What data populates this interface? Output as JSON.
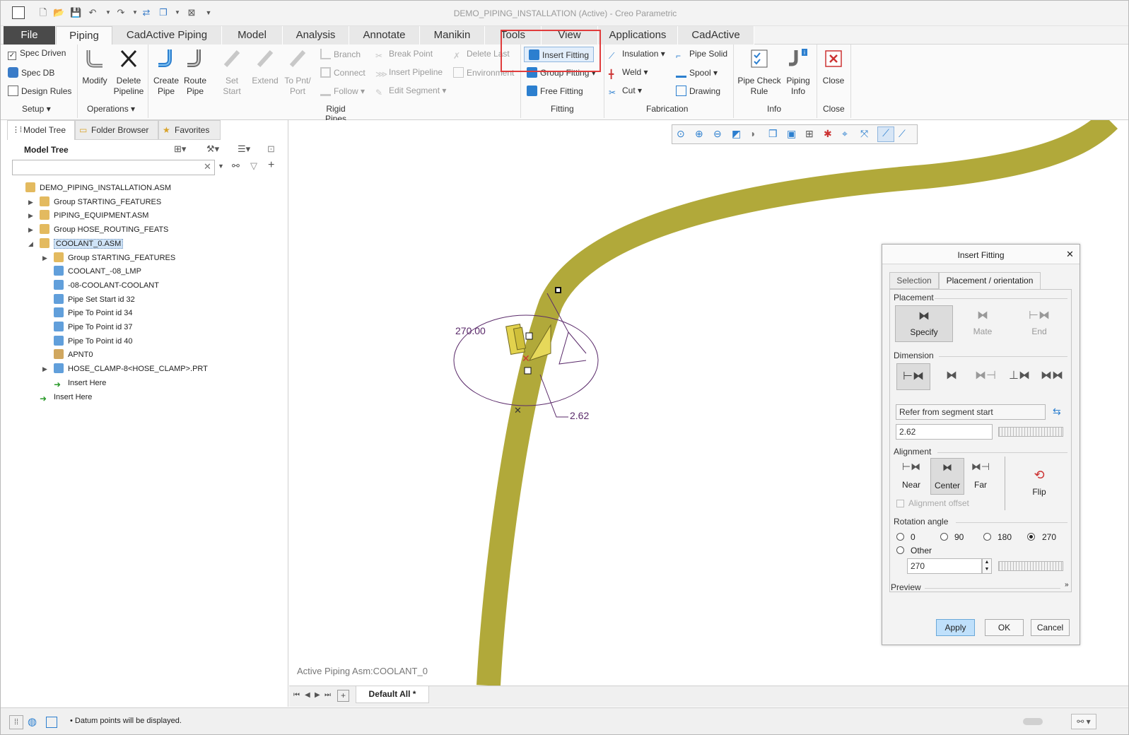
{
  "window": {
    "title": "DEMO_PIPING_INSTALLATION (Active) - Creo Parametric"
  },
  "menu_tabs": [
    {
      "label": "File"
    },
    {
      "label": "Piping"
    },
    {
      "label": "CadActive Piping"
    },
    {
      "label": "Model"
    },
    {
      "label": "Analysis"
    },
    {
      "label": "Annotate"
    },
    {
      "label": "Manikin"
    },
    {
      "label": "Tools"
    },
    {
      "label": "View"
    },
    {
      "label": "Applications"
    },
    {
      "label": "CadActive"
    }
  ],
  "ribbon": {
    "setup": {
      "spec_driven": "Spec Driven",
      "spec_db": "Spec DB",
      "design_rules": "Design Rules",
      "group": "Setup"
    },
    "operations": {
      "modify": "Modify",
      "delete_pipeline": "Delete Pipeline",
      "group": "Operations"
    },
    "rigid_pipes": {
      "create_pipe": "Create Pipe",
      "route_pipe": "Route Pipe",
      "set_start": "Set Start",
      "extend": "Extend",
      "to_pnt_port": "To Pnt/ Port",
      "branch": "Branch",
      "connect": "Connect",
      "follow": "Follow",
      "break_point": "Break Point",
      "insert_pipeline": "Insert Pipeline",
      "edit_segment": "Edit Segment",
      "delete_last": "Delete Last",
      "environment": "Environment",
      "group": "Rigid Pipes"
    },
    "fitting": {
      "insert_fitting": "Insert Fitting",
      "group_fitting": "Group Fitting",
      "free_fitting": "Free Fitting",
      "group": "Fitting"
    },
    "fabrication": {
      "insulation": "Insulation",
      "weld": "Weld",
      "cut": "Cut",
      "pipe_solid": "Pipe Solid",
      "spool": "Spool",
      "drawing": "Drawing",
      "group": "Fabrication"
    },
    "info": {
      "pipe_check_rule": "Pipe Check Rule",
      "piping_info": "Piping Info",
      "group": "Info"
    },
    "close": {
      "close": "Close",
      "group": "Close"
    }
  },
  "left_panel": {
    "tabs": [
      {
        "label": "Model Tree"
      },
      {
        "label": "Folder Browser"
      },
      {
        "label": "Favorites"
      }
    ],
    "header": "Model Tree",
    "search_placeholder": "",
    "tree": [
      {
        "label": "DEMO_PIPING_INSTALLATION.ASM"
      },
      {
        "label": "Group STARTING_FEATURES"
      },
      {
        "label": "PIPING_EQUIPMENT.ASM"
      },
      {
        "label": "Group HOSE_ROUTING_FEATS"
      },
      {
        "label": "COOLANT_0.ASM"
      },
      {
        "label": "Group STARTING_FEATURES"
      },
      {
        "label": "COOLANT_-08_LMP"
      },
      {
        "label": "-08-COOLANT-COOLANT"
      },
      {
        "label": "Pipe Set Start id 32"
      },
      {
        "label": "Pipe To Point id 34"
      },
      {
        "label": "Pipe To Point id 37"
      },
      {
        "label": "Pipe To Point id 40"
      },
      {
        "label": "APNT0"
      },
      {
        "label": "HOSE_CLAMP-8<HOSE_CLAMP>.PRT"
      },
      {
        "label": "Insert Here"
      },
      {
        "label": "Insert Here"
      }
    ]
  },
  "viewport": {
    "angle_dim": "270.00",
    "offset_dim": "2.62",
    "active_asm": "Active Piping Asm:COOLANT_0",
    "pipe_color": "#b1a93a"
  },
  "dialog": {
    "title": "Insert Fitting",
    "tabs": [
      {
        "label": "Selection"
      },
      {
        "label": "Placement / orientation"
      }
    ],
    "placement": {
      "header": "Placement",
      "specify": "Specify",
      "mate": "Mate",
      "end": "End"
    },
    "dimension": {
      "header": "Dimension",
      "reference": "Refer from segment start",
      "value": "2.62"
    },
    "alignment": {
      "header": "Alignment",
      "near": "Near",
      "center": "Center",
      "far": "Far",
      "flip": "Flip",
      "offset": "Alignment offset"
    },
    "rotation": {
      "header": "Rotation angle",
      "opt0": "0",
      "opt90": "90",
      "opt180": "180",
      "opt270": "270",
      "other": "Other",
      "value": "270",
      "selected": "270"
    },
    "preview": "Preview",
    "apply": "Apply",
    "ok": "OK",
    "cancel": "Cancel"
  },
  "view_bar": {
    "tab": "Default All *"
  },
  "status": {
    "message": "Datum points will be displayed."
  },
  "highlight_color": "#e03c3c"
}
